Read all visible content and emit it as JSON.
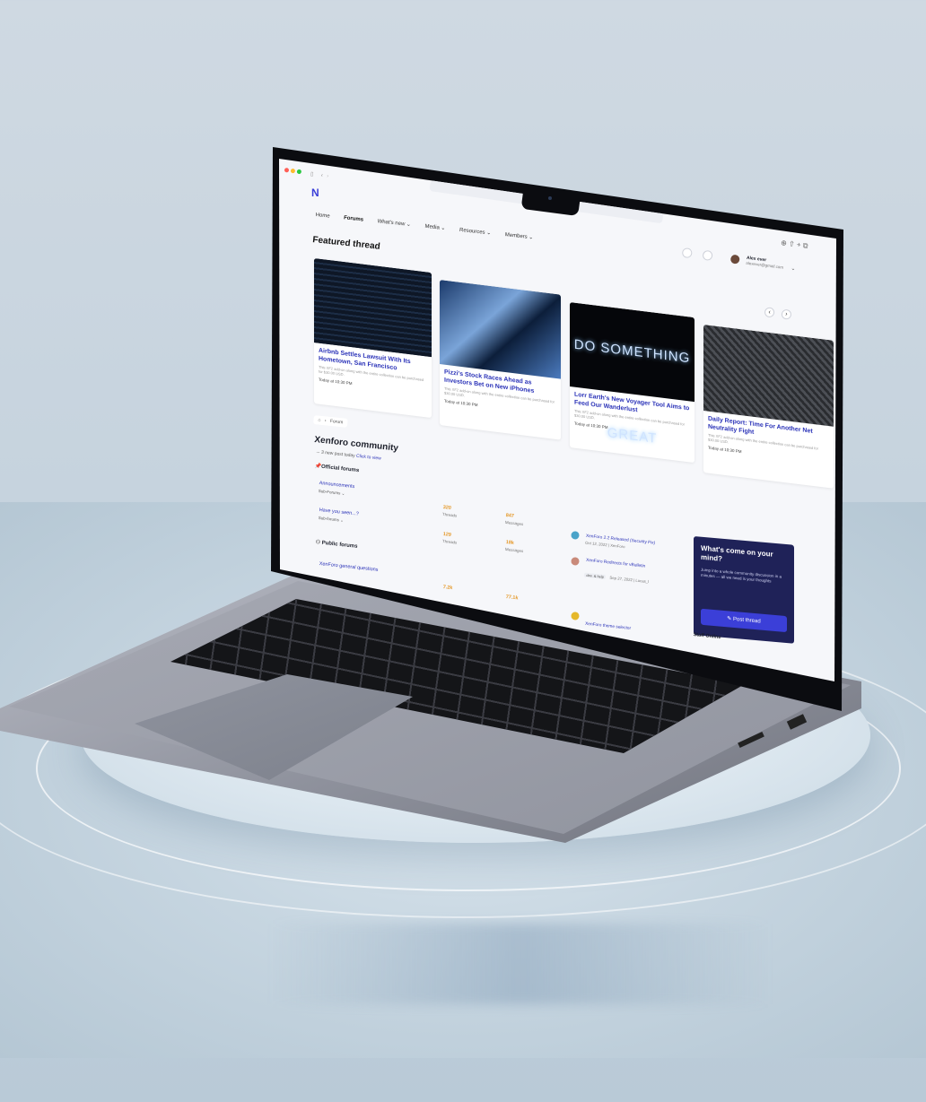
{
  "site": {
    "nav": [
      "Home",
      "Forums",
      "What's new ⌄",
      "Media ⌄",
      "Resources ⌄",
      "Members ⌄"
    ],
    "user": {
      "name": "Alex ever",
      "email": "alexever@gmail.com"
    }
  },
  "featured": {
    "heading": "Featured thread",
    "cards": [
      {
        "title": "Airbnb Settles Lawsuit With Its Hometown, San Francisco",
        "desc": "This XF2 add-on along with the entire collection can be purchased for $30.00 USD.",
        "date": "Today at 10:30 PM"
      },
      {
        "title": "Pizzi's Stock Races Ahead as Investors Bet on New iPhones",
        "desc": "This XF2 add-on along with the entire collection can be purchased for $30.00 USD.",
        "date": "Today at 10:30 PM"
      },
      {
        "title": "Lorr Earth's New Voyager Tool Aims to Feed Our Wanderlust",
        "desc": "This XF2 add-on along with the entire collection can be purchased for $30.00 USD.",
        "date": "Today at 10:30 PM",
        "image_text": "DO SOMETHING GREAT"
      },
      {
        "title": "Daily Report: Time For Another Net Neutrality Fight",
        "desc": "This XF2 add-on along with the entire collection can be purchased for $30.00 USD.",
        "date": "Today at 10:30 PM"
      }
    ]
  },
  "breadcrumb": {
    "home": "⌂",
    "sep": "›",
    "current": "Forum"
  },
  "community": {
    "title": "Xenforo community",
    "subtitle": "→ 3 new post today",
    "subtitle_link": "Click to view",
    "official_heading": "Official forums",
    "public_heading": "Public forums",
    "forums": [
      {
        "name": "Announcements",
        "sub": "Sub-Forums ⌄",
        "threads": "320",
        "threads_label": "Threads",
        "messages": "847",
        "messages_label": "Messages",
        "latest": "XenForo 2.2 Released (Security Fix)",
        "latest_meta": "Oct 12, 2022 | XenForo"
      },
      {
        "name": "Have you seen...?",
        "sub": "Sub-forums ⌄",
        "threads": "129",
        "threads_label": "Threads",
        "messages": "18k",
        "messages_label": "Messages",
        "latest": "XenForo Redirects for vBulletin",
        "latest_meta": "Sep 27, 2022 | Lucas_l",
        "tag": "dev. & help"
      },
      {
        "name": "XenForo general questions",
        "threads": "7.2k",
        "messages": "77.1k",
        "latest": "XenForo theme selector"
      }
    ]
  },
  "sidebar": {
    "panel_title": "What's come on your mind?",
    "panel_text": "Jump into a whole community discussion in a minutes — all we need is your thoughts",
    "post_button": "Post thread",
    "staff_title": "Staff Online"
  },
  "colors": {
    "accent": "#2b33b8",
    "brand": "#3b3fd8",
    "panel": "#1f2258",
    "highlight": "#e59a2b"
  }
}
